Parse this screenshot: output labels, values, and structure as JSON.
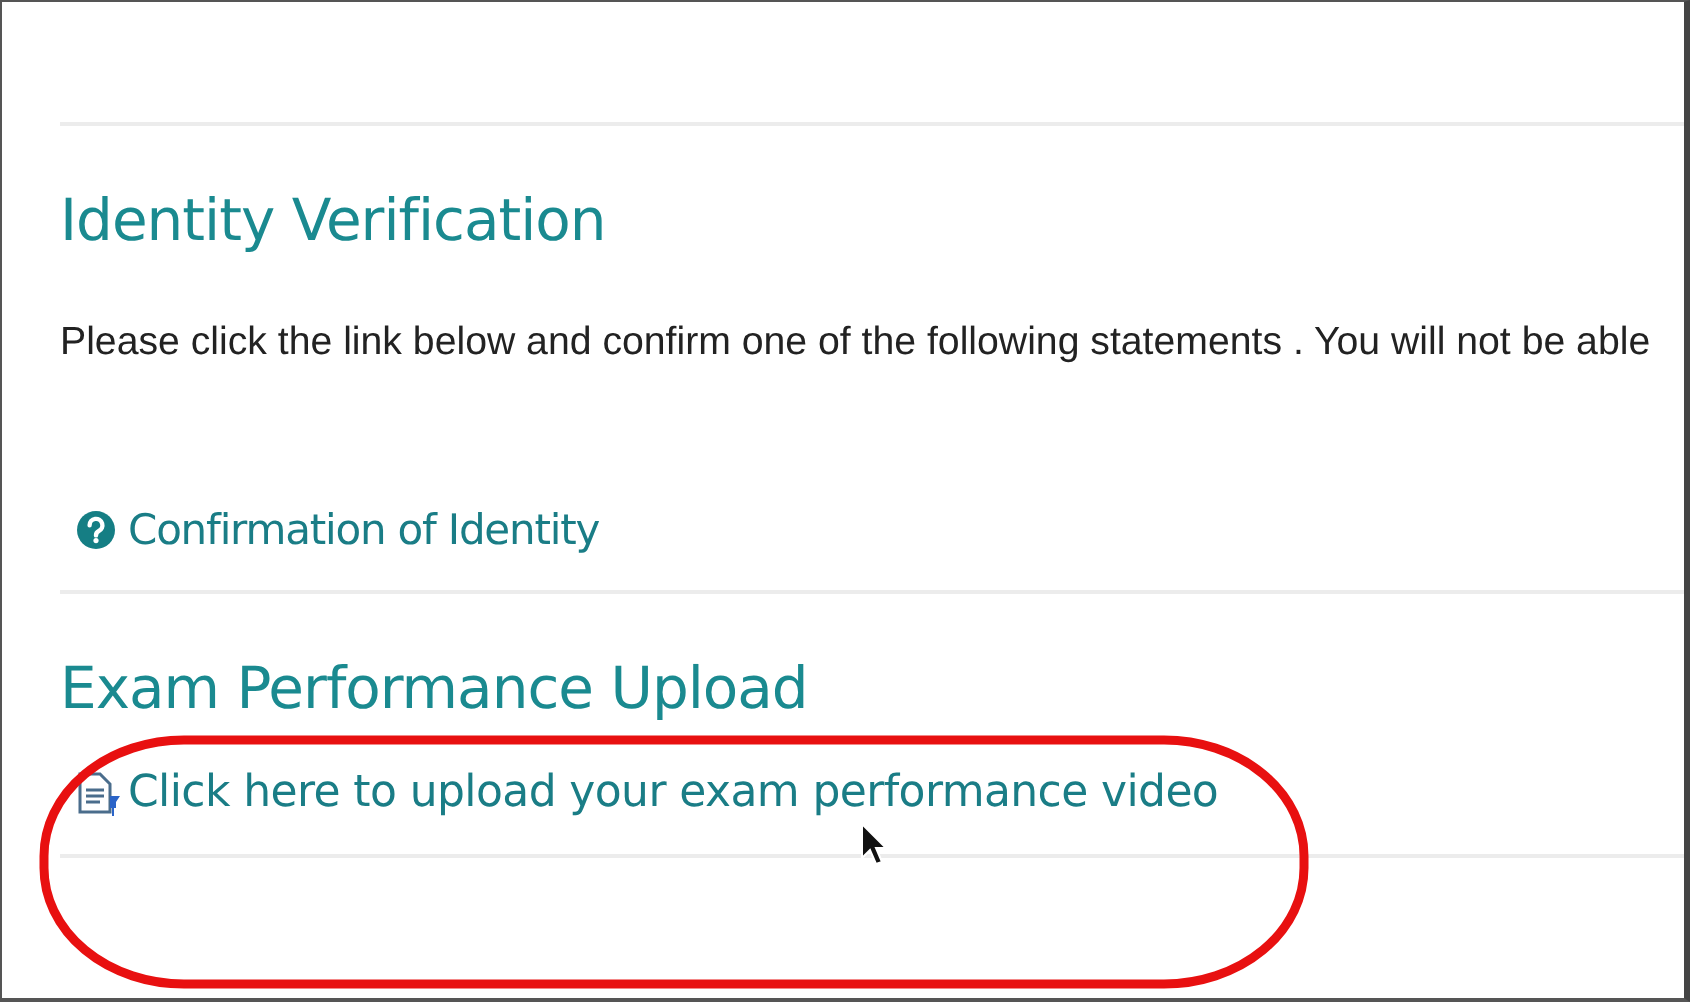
{
  "sections": [
    {
      "kind": "text",
      "heading": "Identity Verification",
      "text": "Please click the link below and confirm one of the following statements . You will not be able",
      "link": "Confirmation of Identity"
    },
    {
      "kind": "upload",
      "heading": "Exam Performance Upload",
      "link": "Click here to upload your exam performance video"
    }
  ]
}
